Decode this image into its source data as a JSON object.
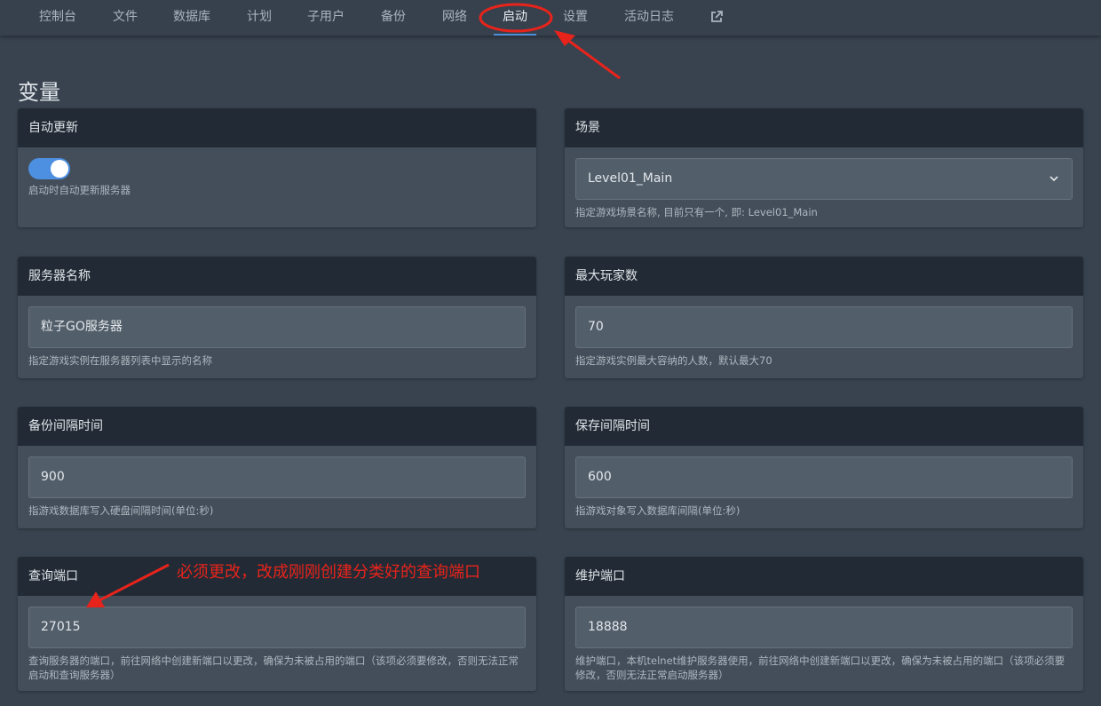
{
  "nav": {
    "items": [
      {
        "label": "控制台"
      },
      {
        "label": "文件"
      },
      {
        "label": "数据库"
      },
      {
        "label": "计划"
      },
      {
        "label": "子用户"
      },
      {
        "label": "备份"
      },
      {
        "label": "网络"
      },
      {
        "label": "启动",
        "active": true
      },
      {
        "label": "设置"
      },
      {
        "label": "活动日志"
      }
    ],
    "external_icon": "external-link-icon"
  },
  "page": {
    "title": "变量"
  },
  "cards": {
    "auto_update": {
      "title": "自动更新",
      "toggle_on": true,
      "help": "启动时自动更新服务器"
    },
    "scene": {
      "title": "场景",
      "selected": "Level01_Main",
      "help": "指定游戏场景名称, 目前只有一个, 即: Level01_Main"
    },
    "server_name": {
      "title": "服务器名称",
      "value": "粒子GO服务器",
      "help": "指定游戏实例在服务器列表中显示的名称"
    },
    "max_players": {
      "title": "最大玩家数",
      "value": "70",
      "help": "指定游戏实例最大容纳的人数，默认最大70"
    },
    "backup_interval": {
      "title": "备份间隔时间",
      "value": "900",
      "help": "指游戏数据库写入硬盘间隔时间(单位:秒)"
    },
    "save_interval": {
      "title": "保存间隔时间",
      "value": "600",
      "help": "指游戏对象写入数据库间隔(单位:秒)"
    },
    "query_port": {
      "title": "查询端口",
      "value": "27015",
      "help": "查询服务器的端口，前往网络中创建新端口以更改，确保为未被占用的端口（该项必须要修改，否则无法正常启动和查询服务器）"
    },
    "maintenance_port": {
      "title": "维护端口",
      "value": "18888",
      "help": "维护端口，本机telnet维护服务器使用，前往网络中创建新端口以更改，确保为未被占用的端口（该项必须要修改，否则无法正常启动服务器）"
    }
  },
  "annotation": {
    "text": "必须更改，改成刚刚创建分类好的查询端口",
    "color": "#e8231b"
  },
  "colors": {
    "background": "#38434f",
    "card_header": "#222b35",
    "accent": "#4d8fe0"
  }
}
